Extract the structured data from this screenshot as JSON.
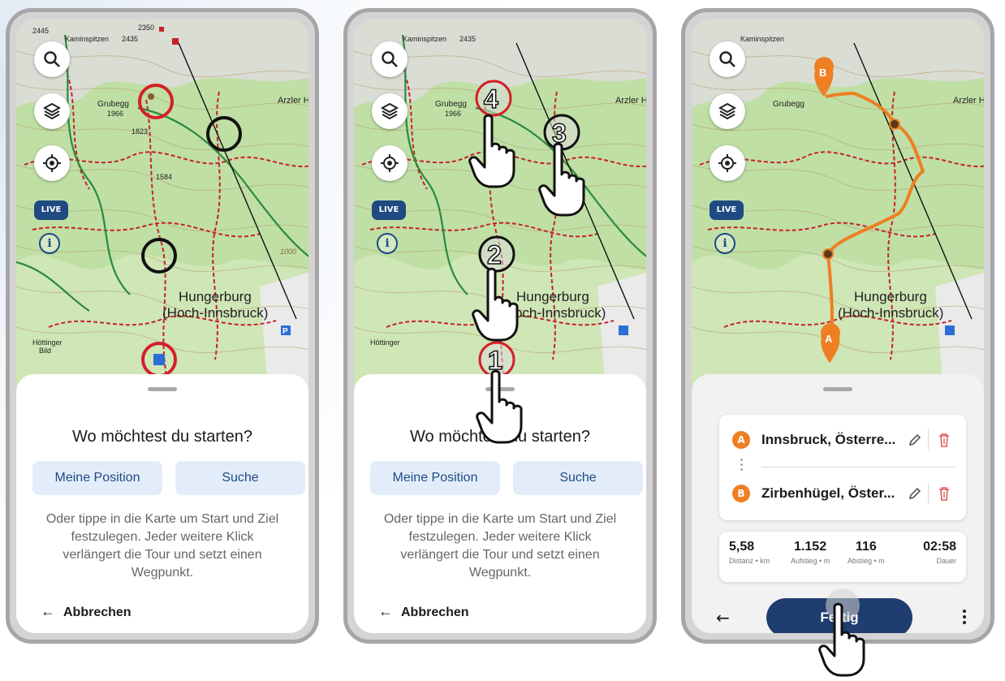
{
  "map": {
    "labels": {
      "kaminspitzen": "Kaminspitzen",
      "grubegg": "Grubegg",
      "grubegg_elev": "1966",
      "elev_1823": "1823",
      "elev_1584": "1584",
      "elev_2435": "2435",
      "elev_2350": "2350",
      "elev_2445": "2445",
      "arzler": "Arzler H",
      "hungerburg": "Hungerburg",
      "hoch_innsbruck": "(Hoch-Innsbruck)",
      "hottinger": "Höttinger",
      "bild": "Bild",
      "contour_1000": "1000"
    },
    "controls": {
      "search_icon": "search-icon",
      "layers_icon": "layers-icon",
      "locate_icon": "locate-icon",
      "live_badge": "LIVE",
      "info_icon": "i"
    },
    "parking": "P",
    "route_color": "#ee7f22"
  },
  "screen1": {
    "title": "Wo möchtest du starten?",
    "btn_position": "Meine Position",
    "btn_search": "Suche",
    "hint": "Oder tippe in die Karte um Start und Ziel festzulegen. Jeder weitere Klick verlängert die Tour und setzt einen Wegpunkt.",
    "cancel": "Abbrechen"
  },
  "screen2": {
    "title": "Wo möchtest du starten?",
    "btn_position": "Meine Position",
    "btn_search": "Suche",
    "hint": "Oder tippe in die Karte um Start und Ziel festzulegen. Jeder weitere Klick verlängert die Tour und setzt einen Wegpunkt.",
    "cancel": "Abbrechen",
    "steps": [
      "1",
      "2",
      "3",
      "4"
    ]
  },
  "screen3": {
    "start": {
      "badge": "A",
      "name": "Innsbruck, Österre..."
    },
    "end": {
      "badge": "B",
      "name": "Zirbenhügel, Öster..."
    },
    "stats": [
      {
        "value": "5,58",
        "label": "Distanz • km"
      },
      {
        "value": "1.152",
        "label": "Aufstieg • m"
      },
      {
        "value": "116",
        "label": "Abstieg • m"
      },
      {
        "value": "02:58",
        "label": "Dauer"
      }
    ],
    "done": "Fertig"
  }
}
